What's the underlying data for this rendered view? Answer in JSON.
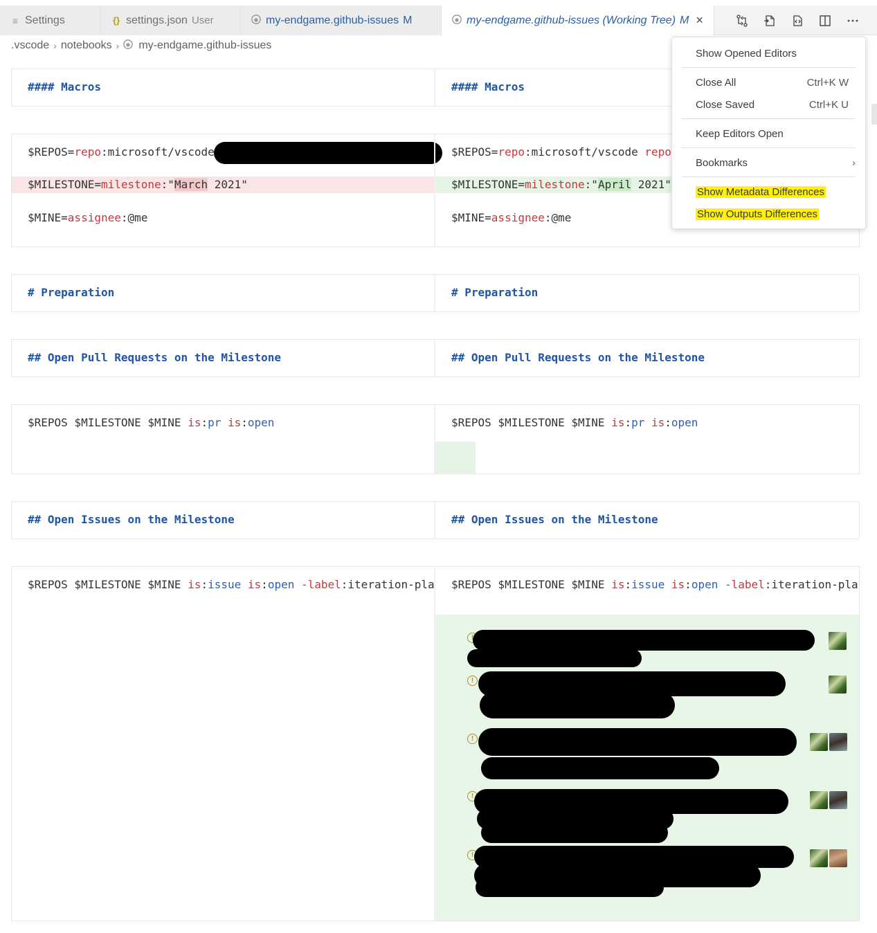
{
  "tabs": [
    {
      "icon": "hamburger-icon",
      "label": "Settings",
      "description": "",
      "modified": ""
    },
    {
      "icon": "json-braces-icon",
      "label": "settings.json",
      "description": "User",
      "modified": ""
    },
    {
      "icon": "github-icon",
      "label": "my-endgame.github-issues",
      "description": "",
      "modified": "M"
    },
    {
      "icon": "github-icon",
      "label": "my-endgame.github-issues (Working Tree)",
      "description": "",
      "modified": "M"
    }
  ],
  "breadcrumb": [
    ".vscode",
    "notebooks",
    "my-endgame.github-issues"
  ],
  "editor_actions": [
    "open-changes-icon",
    "open-file-icon",
    "inline-view-icon",
    "split-editor-icon",
    "more-actions-icon"
  ],
  "cells": {
    "macros_heading": "#### Macros",
    "repos_prefix": "$REPOS=",
    "repo_kw": "repo",
    "repo_value": ":microsoft/vscode",
    "repo_value_right": ":microsoft/vscode ",
    "repo_kw2": "repo",
    "milestone_prefix": "$MILESTONE=",
    "milestone_kw": "milestone",
    "milestone_colon": ":\"",
    "milestone_left_word": "March",
    "milestone_right_word": "April",
    "milestone_year": " 2021\"",
    "mine_prefix": "$MINE=",
    "assignee_kw": "assignee",
    "assignee_value": ":@me",
    "preparation_heading": "# Preparation",
    "open_prs_heading": "## Open Pull Requests on the Milestone",
    "pr_query_prefix": "$REPOS $MILESTONE $MINE ",
    "is_kw": "is",
    "pr_val": "pr",
    "open_val": "open",
    "open_issues_heading": "## Open Issues on the Milestone",
    "issue_val": "issue",
    "label_kw": "-label",
    "issue_tail_left": ":iteration-pla",
    "issue_tail_right": ":iteration-pla"
  },
  "output_rows": [
    {
      "avatars": [
        "a"
      ]
    },
    {
      "avatars": [
        "a"
      ]
    },
    {
      "avatars": [
        "a",
        "b"
      ]
    },
    {
      "avatars": [
        "a",
        "b"
      ]
    },
    {
      "avatars": [
        "a",
        "c"
      ]
    }
  ],
  "menu": {
    "show_opened_editors": "Show Opened Editors",
    "close_all": "Close All",
    "close_all_kb": "Ctrl+K W",
    "close_saved": "Close Saved",
    "close_saved_kb": "Ctrl+K U",
    "keep_editors_open": "Keep Editors Open",
    "bookmarks": "Bookmarks",
    "show_metadata_diff": "Show Metadata Differences",
    "show_outputs_diff": "Show Outputs Differences"
  },
  "colors": {
    "highlight": "#fff200",
    "keyword": "#c8373b",
    "value": "#2a5fb5",
    "heading": "#1e55a8",
    "deleted_bg": "#f9e5e5",
    "inserted_bg": "#e6f4e6"
  }
}
